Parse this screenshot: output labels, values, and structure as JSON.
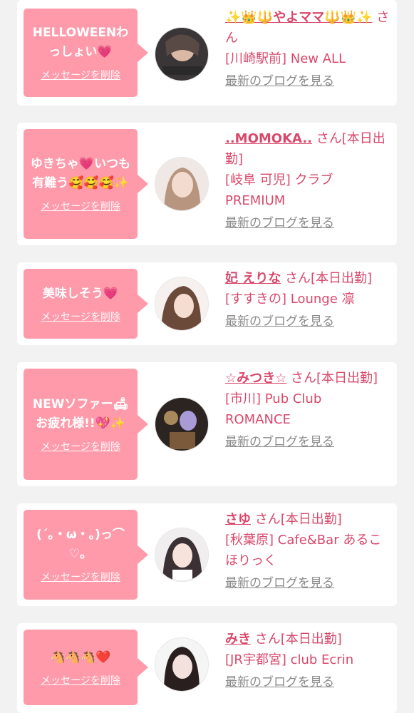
{
  "colors": {
    "bubble": "#ff9aab",
    "accent": "#d9486b",
    "link_gray": "#8a8a8a"
  },
  "delete_label": "メッセージを削除",
  "blog_label": "最新のブログを見る",
  "cards": [
    {
      "message": "HELLOWEENわっしょい💗",
      "name": "✨👑🔱やよママ🔱👑✨",
      "suffix": "さん",
      "shop": "[川崎駅前] New ALL"
    },
    {
      "message": "ゆきちゃ💗いつも有難う🥰🥰🥰✨",
      "name": "..MOMOKA..",
      "suffix": "さん[本日出勤]",
      "shop": "[岐阜 可児] クラブPREMIUM"
    },
    {
      "message": "美味しそう💗",
      "name": "妃 えりな",
      "suffix": "さん[本日出勤]",
      "shop": "[すすきの] Lounge 凛"
    },
    {
      "message": "NEWソファー🛋お疲れ様!!💖✨",
      "name": "☆みつき☆",
      "suffix": "さん[本日出勤]",
      "shop": "[市川] Pub Club ROMANCE"
    },
    {
      "message": "(´。・ω・。)っ⌒♡。",
      "name": "さゆ",
      "suffix": "さん[本日出勤]",
      "shop": "[秋葉原] Cafe&Bar あるこほりっく"
    },
    {
      "message": "🐴🐴🐴❤️",
      "name": "みき",
      "suffix": "さん[本日出勤]",
      "shop": "[JR宇都宮] club Ecrin"
    }
  ]
}
